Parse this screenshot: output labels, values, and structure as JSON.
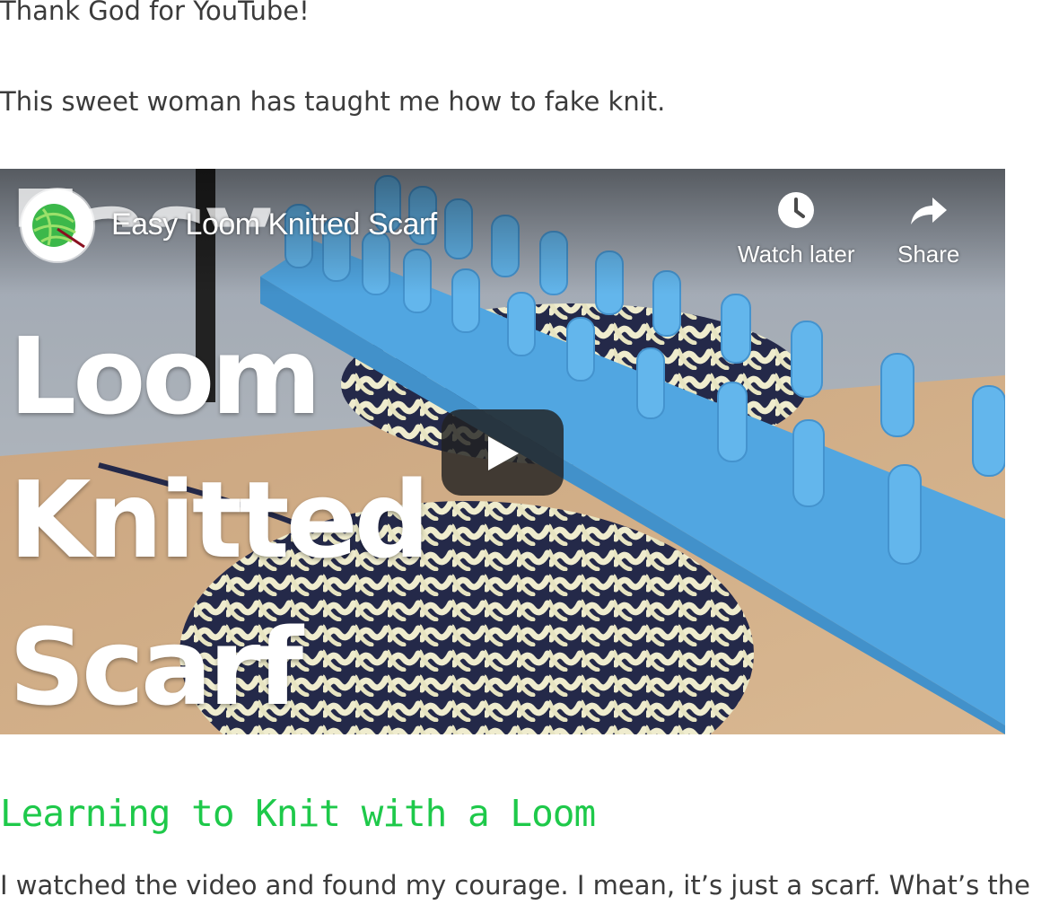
{
  "article": {
    "paragraph_1": "Thank God for YouTube!",
    "paragraph_2": "This sweet woman has taught me how to fake knit.",
    "heading": "Learning to Knit with a Loom",
    "paragraph_3": "I watched the video and found my courage. I mean, it’s just a scarf. What’s the"
  },
  "video": {
    "title": "Easy Loom Knitted Scarf",
    "thumbnail_text": [
      "Easy",
      "Loom",
      "Knitted",
      "Scarf"
    ],
    "actions": {
      "watch_later_label": "Watch later",
      "watch_later_icon": "clock-icon",
      "share_label": "Share",
      "share_icon": "share-arrow-icon"
    },
    "play_icon": "play-icon"
  },
  "colors": {
    "heading": "#1ec94a",
    "body_text": "#3b3b3b",
    "loom_blue": "#4aa3e0"
  }
}
